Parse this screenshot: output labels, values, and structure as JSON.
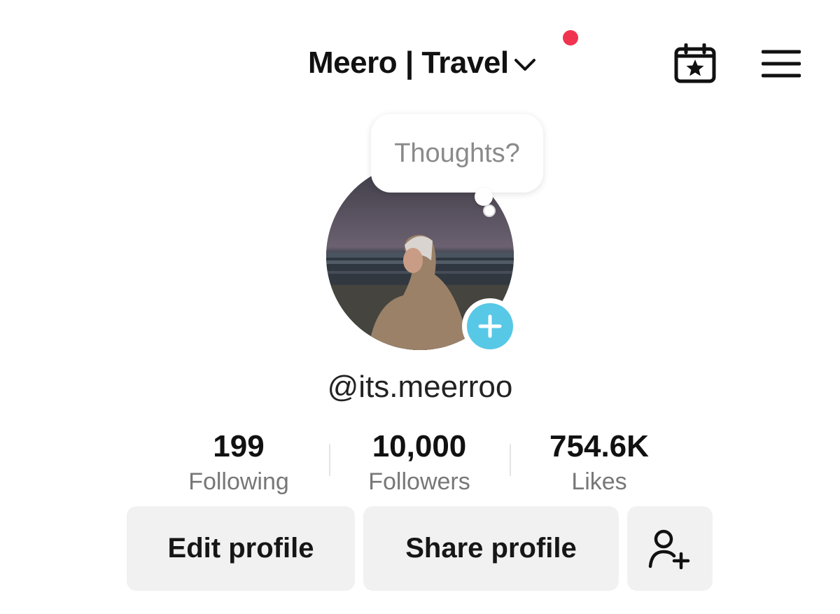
{
  "header": {
    "account_name": "Meero | Travel",
    "notification_dot_color": "#f0344f",
    "icons": [
      "chevron-down-icon",
      "calendar-star-icon",
      "hamburger-menu-icon"
    ]
  },
  "profile": {
    "thought_bubble": "Thoughts?",
    "username": "@its.meerroo",
    "add_button_color": "#57c8e6"
  },
  "stats": [
    {
      "count": "199",
      "label": "Following"
    },
    {
      "count": "10,000",
      "label": "Followers"
    },
    {
      "count": "754.6K",
      "label": "Likes"
    }
  ],
  "actions": {
    "edit_label": "Edit profile",
    "share_label": "Share profile",
    "add_friend_icon": "add-friend-icon"
  }
}
